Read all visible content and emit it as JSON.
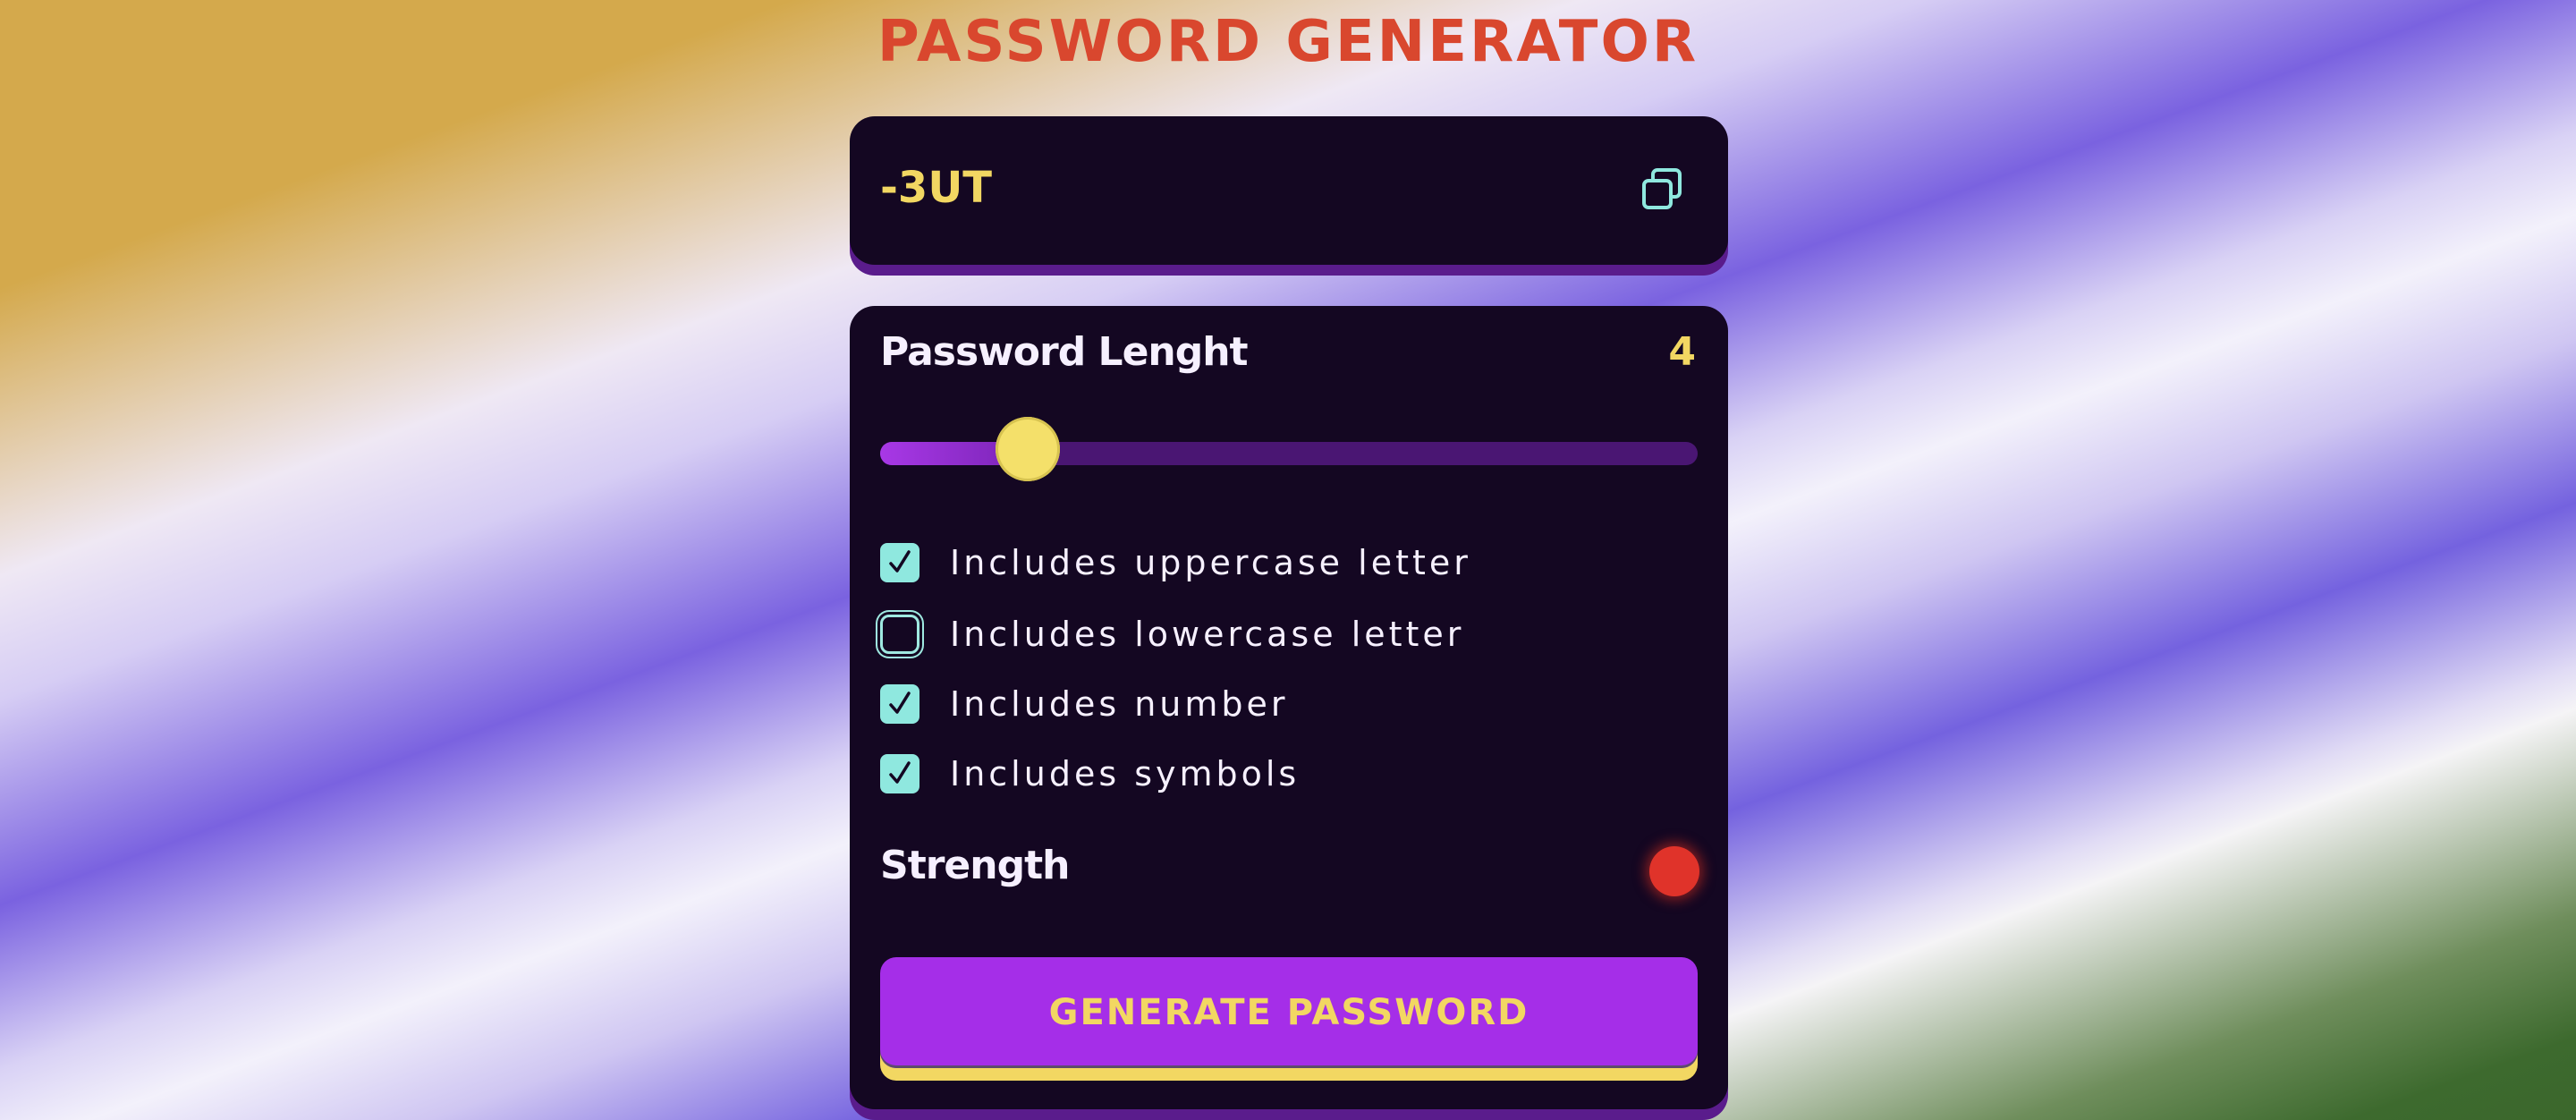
{
  "app": {
    "title": "PASSWORD GENERATOR"
  },
  "output": {
    "password": "-3UT",
    "copy_icon": "copy-icon"
  },
  "length": {
    "label": "Password Lenght",
    "value": "4",
    "slider_fraction": 0.18
  },
  "options": [
    {
      "label": "Includes uppercase letter",
      "checked": true
    },
    {
      "label": "Includes lowercase letter",
      "checked": false
    },
    {
      "label": "Includes number",
      "checked": true
    },
    {
      "label": "Includes symbols",
      "checked": true
    }
  ],
  "strength": {
    "label": "Strength",
    "indicator_color": "#e0332a"
  },
  "generate": {
    "label": "GENERATE PASSWORD"
  },
  "colors": {
    "accent_yellow": "#f2d762",
    "accent_purple": "#a52ee8",
    "panel_bg": "#140722",
    "checkbox_teal": "#8fe8df",
    "title_red": "#d9472e"
  }
}
